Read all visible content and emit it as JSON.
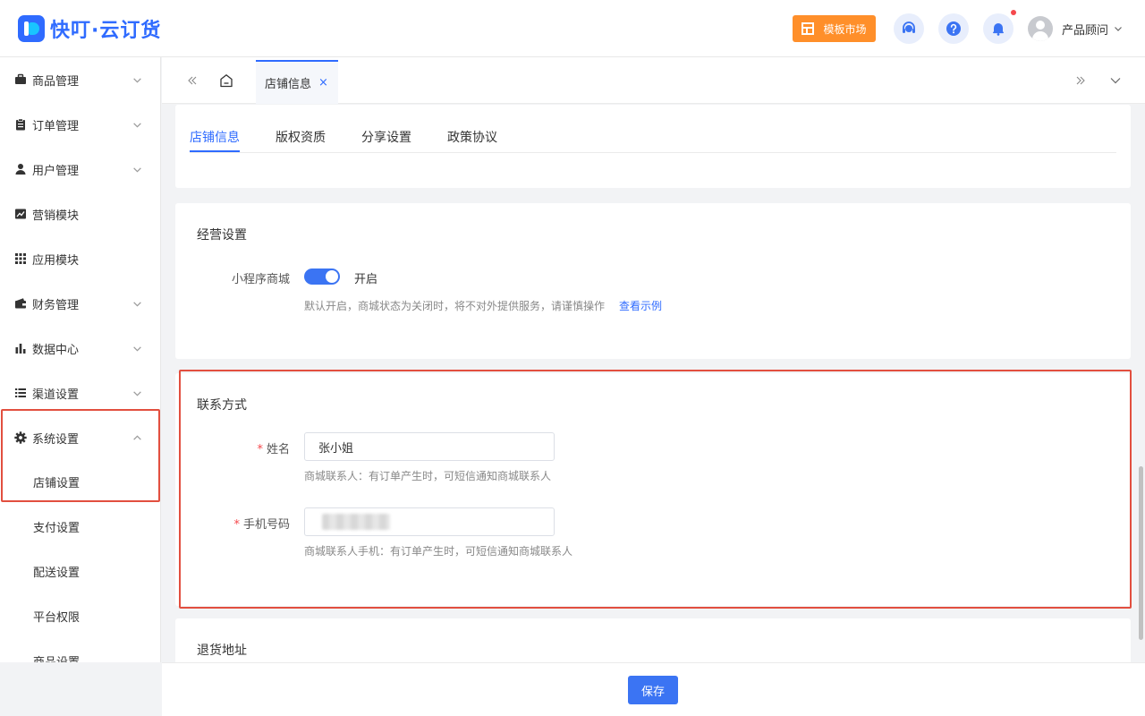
{
  "app": {
    "name": "快叮·云订货"
  },
  "header": {
    "market_label": "模板市场",
    "user_name": "产品顾问"
  },
  "sidebar": {
    "items": [
      {
        "label": "商品管理",
        "icon": "briefcase-icon"
      },
      {
        "label": "订单管理",
        "icon": "clipboard-icon"
      },
      {
        "label": "用户管理",
        "icon": "user-icon"
      },
      {
        "label": "营销模块",
        "icon": "chart-line-icon"
      },
      {
        "label": "应用模块",
        "icon": "grid-icon"
      },
      {
        "label": "财务管理",
        "icon": "wallet-icon"
      },
      {
        "label": "数据中心",
        "icon": "bar-chart-icon"
      },
      {
        "label": "渠道设置",
        "icon": "list-icon"
      },
      {
        "label": "系统设置",
        "icon": "gear-icon",
        "expanded": true
      }
    ],
    "sub_items": [
      "店铺设置",
      "支付设置",
      "配送设置",
      "平台权限",
      "商品设置"
    ],
    "active_sub_item": "店铺设置"
  },
  "tabbar": {
    "tabs": [
      {
        "label": "店铺信息",
        "active": true
      }
    ]
  },
  "sub_tabs": [
    "店铺信息",
    "版权资质",
    "分享设置",
    "政策协议"
  ],
  "active_sub_tab": "店铺信息",
  "business": {
    "title": "经营设置",
    "mini_shop_label": "小程序商城",
    "mini_shop_status": "开启",
    "mini_shop_enabled": true,
    "hint": "默认开启，商城状态为关闭时，将不对外提供服务，请谨慎操作",
    "example_link": "查看示例"
  },
  "contact": {
    "title": "联系方式",
    "name_label": "姓名",
    "name_value": "张小姐",
    "name_hint": "商城联系人：有订单产生时，可短信通知商城联系人",
    "phone_label": "手机号码",
    "phone_hint": "商城联系人手机：有订单产生时，可短信通知商城联系人"
  },
  "returns": {
    "title": "退货地址"
  },
  "footer": {
    "save_label": "保存"
  },
  "colors": {
    "primary": "#2f6bff",
    "market": "#ff8f2a",
    "highlight": "#e24f3f"
  }
}
